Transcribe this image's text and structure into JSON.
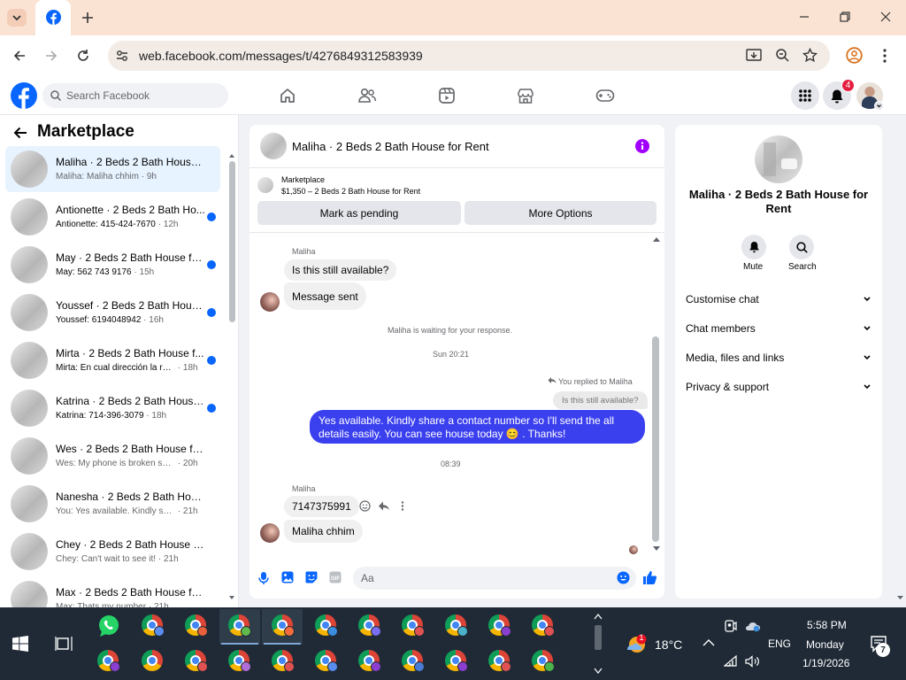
{
  "browser": {
    "url": "web.facebook.com/messages/t/4276849312583939",
    "tab_icon": "facebook-icon",
    "colors": {
      "tabbar": "#fbe3d4",
      "omnibox": "#f3ece6"
    }
  },
  "facebook_nav": {
    "search_placeholder": "Search Facebook",
    "notification_count": "4",
    "nav_icons": [
      "home-icon",
      "friends-icon",
      "video-icon",
      "marketplace-icon",
      "gaming-icon"
    ],
    "brand_color": "#0866ff"
  },
  "left_panel": {
    "title": "Marketplace",
    "conversations": [
      {
        "title": "Maliha · 2 Beds 2 Bath House f...",
        "preview": "Maliha: Maliha chhim",
        "time": "9h",
        "unread": false,
        "active": true
      },
      {
        "title": "Antionette · 2 Beds 2 Bath Ho...",
        "preview": "Antionette: 415-424-7670",
        "time": "12h",
        "unread": true,
        "active": false
      },
      {
        "title": "May · 2 Beds 2 Bath House fo...",
        "preview": "May: 562 743 9176",
        "time": "15h",
        "unread": true,
        "active": false
      },
      {
        "title": "Youssef · 2 Beds 2 Bath House...",
        "preview": "Youssef: 6194048942",
        "time": "16h",
        "unread": true,
        "active": false
      },
      {
        "title": "Mirta · 2 Beds 2 Bath House f...",
        "preview": "Mirta: En cual dirección la renta",
        "time": "18h",
        "unread": true,
        "active": false
      },
      {
        "title": "Katrina · 2 Beds 2 Bath House...",
        "preview": "Katrina: 714-396-3079",
        "time": "18h",
        "unread": true,
        "active": false
      },
      {
        "title": "Wes · 2 Beds 2 Bath House for ...",
        "preview": "Wes: My phone is broken so we c...",
        "time": "20h",
        "unread": false,
        "active": false
      },
      {
        "title": "Nanesha · 2 Beds 2 Bath House ...",
        "preview": "You: Yes available. Kindly share a ...",
        "time": "21h",
        "unread": false,
        "active": false
      },
      {
        "title": "Chey · 2 Beds 2 Bath House for ...",
        "preview": "Chey: Can't wait to see it!",
        "time": "21h",
        "unread": false,
        "active": false
      },
      {
        "title": "Max · 2 Beds 2 Bath House for ...",
        "preview": "Max: Thats my number",
        "time": "21h",
        "unread": false,
        "active": false
      }
    ]
  },
  "chat": {
    "header_title": "Maliha · 2 Beds 2 Bath House for Rent",
    "marketplace_label": "Marketplace",
    "listing_line": "$1,350 – 2 Beds 2 Bath House for Rent",
    "mark_pending_label": "Mark as pending",
    "more_options_label": "More Options",
    "sender1": "Maliha",
    "msg1": "Is this still available?",
    "msg2": "Message sent",
    "waiting_notice": "Maliha is waiting for your response.",
    "timestamp1": "Sun 20:21",
    "replied_label": "You replied to Maliha",
    "quoted": "Is this still available?",
    "outgoing": "Yes available. Kindly share a contact number so I'll send the all details easily. You can see house today 😊 . Thanks!",
    "timestamp2": "08:39",
    "sender2": "Maliha",
    "msg3": "7147375991",
    "msg4": "Maliha chhim",
    "composer_placeholder": "Aa",
    "outgoing_color": "#3b40ef"
  },
  "right_panel": {
    "title": "Maliha · 2 Beds 2 Bath House for Rent",
    "mute_label": "Mute",
    "search_label": "Search",
    "sections": [
      "Customise chat",
      "Chat members",
      "Media, files and links",
      "Privacy & support"
    ]
  },
  "taskbar": {
    "weather_temp": "18°C",
    "weather_badge": "1",
    "language": "ENG",
    "time": "5:58 PM",
    "day": "Monday",
    "date": "1/19/2026",
    "notification_count": "7"
  }
}
